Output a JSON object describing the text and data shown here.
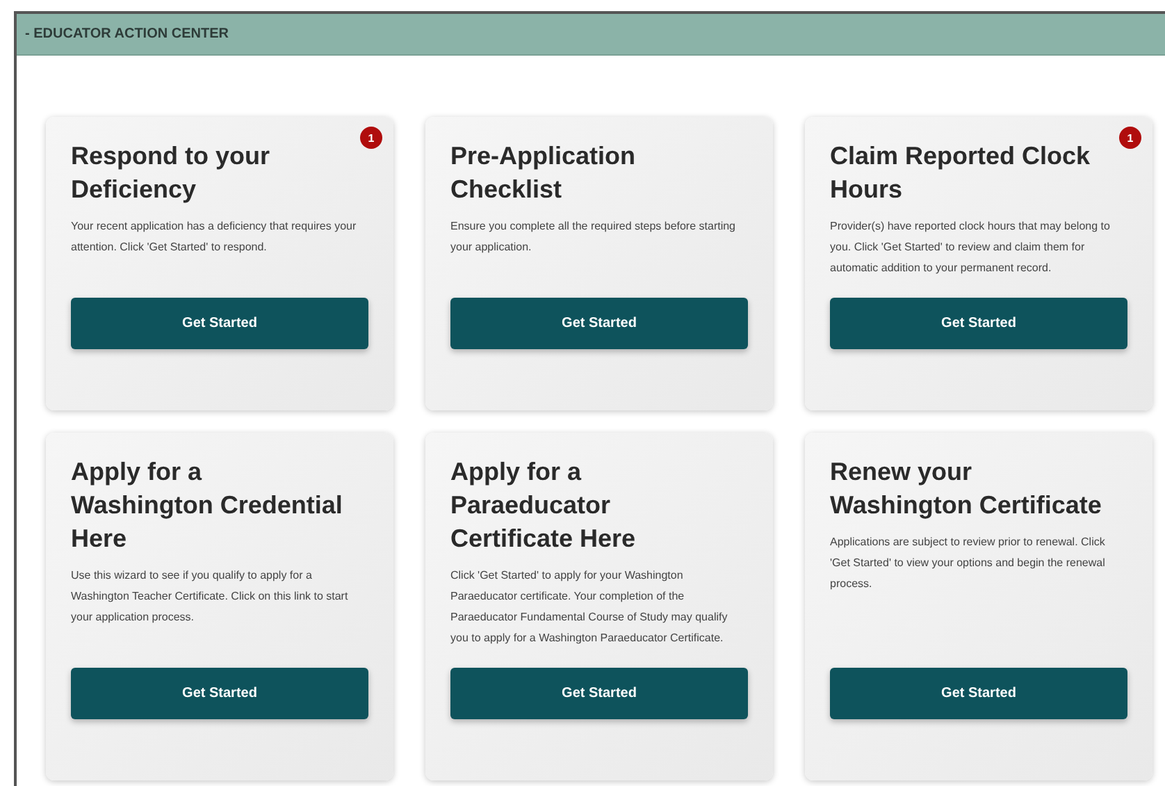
{
  "panel": {
    "title": "- EDUCATOR ACTION CENTER"
  },
  "cards": [
    {
      "title": "Respond to your Deficiency",
      "description": "Your recent application has a deficiency that requires your attention. Click 'Get Started' to respond.",
      "badge": "1",
      "button": "Get Started"
    },
    {
      "title": "Pre-Application Checklist",
      "description": "Ensure you complete all the required steps before starting your application.",
      "button": "Get Started"
    },
    {
      "title": "Claim Reported Clock Hours",
      "description": "Provider(s) have reported clock hours that may belong to you. Click 'Get Started' to review and claim them for automatic addition to your permanent record.",
      "badge": "1",
      "button": "Get Started"
    },
    {
      "title": "Apply for a Washington Credential Here",
      "description": "Use this wizard to see if you qualify to apply for a Washington Teacher Certificate. Click on this link to start your application process.",
      "button": "Get Started"
    },
    {
      "title": "Apply for a Paraeducator Certificate Here",
      "description": "Click 'Get Started' to apply for your Washington Paraeducator certificate. Your completion of the Paraeducator Fundamental Course of Study may qualify you to apply for a Washington Paraeducator Certificate.",
      "button": "Get Started"
    },
    {
      "title": "Renew your Washington Certificate",
      "description": "Applications are subject to review prior to renewal. Click 'Get Started' to view your options and begin the renewal process.",
      "button": "Get Started"
    }
  ]
}
